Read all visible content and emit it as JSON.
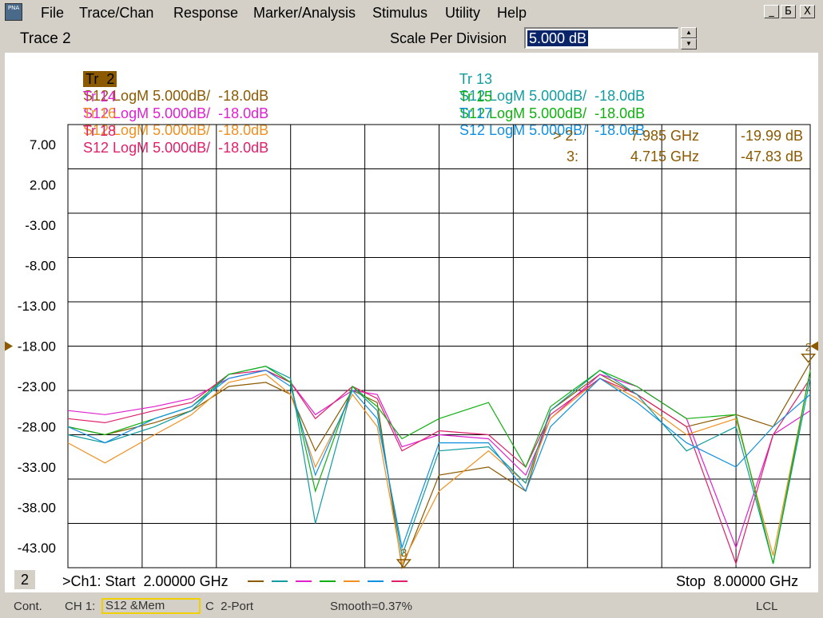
{
  "app": {
    "icon_text": "PNA"
  },
  "menu": [
    "File",
    "Trace/Chan",
    "Response",
    "Marker/Analysis",
    "Stimulus",
    "Utility",
    "Help"
  ],
  "window_controls": {
    "minimize": "_",
    "restore": "Б",
    "close": "X"
  },
  "toolbar": {
    "title": "Trace 2",
    "scale_label": "Scale Per Division",
    "scale_value": "5.000 dB"
  },
  "traces": [
    {
      "tr": "Tr  2",
      "text": "S12 LogM 5.000dB/  -18.0dB",
      "color": "#8b5a00",
      "active": true
    },
    {
      "tr": "Tr 14",
      "text": "S12 LogM 5.000dB/  -18.0dB",
      "color": "#e020d0"
    },
    {
      "tr": "Tr 16",
      "text": "S12 LogM 5.000dB/  -18.0dB",
      "color": "#f09020"
    },
    {
      "tr": "Tr 18",
      "text": "S12 LogM 5.000dB/  -18.0dB",
      "color": "#e0206a"
    },
    {
      "tr": "Tr 13",
      "text": "S12 LogM 5.000dB/  -18.0dB",
      "color": "#109ca0"
    },
    {
      "tr": "Tr 15",
      "text": "S12 LogM 5.000dB/  -18.0dB",
      "color": "#10b010"
    },
    {
      "tr": "Tr 17",
      "text": "S12 LogM 5.000dB/  -18.0dB",
      "color": "#1090e0"
    }
  ],
  "markers": [
    {
      "label": "> 2:",
      "freq": "7.985 GHz",
      "value": "-19.99 dB"
    },
    {
      "label": "3:",
      "freq": "4.715 GHz",
      "value": "-47.83 dB"
    }
  ],
  "chart_data": {
    "type": "line",
    "ylim": [
      -45.5,
      9.5
    ],
    "xlim": [
      2.0,
      8.0
    ],
    "y_ticks": [
      "7.00",
      "2.00",
      "-3.00",
      "-8.00",
      "-13.00",
      "-18.00",
      "-23.00",
      "-28.00",
      "-33.00",
      "-38.00",
      "-43.00"
    ],
    "reference_level": -18.0,
    "grid": true,
    "x_unit": "GHz",
    "y_unit": "dB",
    "marker_points": [
      {
        "name": "2",
        "x": 7.985,
        "y": -19.99
      },
      {
        "name": "3",
        "x": 4.715,
        "y": -47.83
      }
    ],
    "series": [
      {
        "color": "#8b5a00",
        "x": [
          2.0,
          2.3,
          2.7,
          3.0,
          3.3,
          3.6,
          3.8,
          4.0,
          4.3,
          4.5,
          4.7,
          5.0,
          5.4,
          5.7,
          5.9,
          6.3,
          6.6,
          7.0,
          7.4,
          7.7,
          8.0
        ],
        "y": [
          -28,
          -29,
          -27.5,
          -26,
          -23,
          -22.5,
          -24,
          -31,
          -23.5,
          -25,
          -46,
          -34,
          -33,
          -36,
          -26,
          -21.5,
          -24,
          -28,
          -26.5,
          -28,
          -20
        ]
      },
      {
        "color": "#e020d0",
        "x": [
          2.0,
          2.3,
          2.7,
          3.0,
          3.3,
          3.6,
          3.8,
          4.0,
          4.3,
          4.5,
          4.7,
          5.0,
          5.4,
          5.7,
          5.9,
          6.3,
          6.6,
          7.0,
          7.4,
          7.7,
          8.0
        ],
        "y": [
          -26,
          -26.5,
          -25.5,
          -24.5,
          -22,
          -21,
          -22.5,
          -26.5,
          -23.5,
          -24,
          -30.5,
          -29,
          -29.5,
          -34,
          -27,
          -21.5,
          -23,
          -27,
          -43,
          -29,
          -26
        ]
      },
      {
        "color": "#f09020",
        "x": [
          2.0,
          2.3,
          2.7,
          3.0,
          3.3,
          3.6,
          3.8,
          4.0,
          4.3,
          4.5,
          4.7,
          5.0,
          5.4,
          5.7,
          5.9,
          6.3,
          6.6,
          7.0,
          7.4,
          7.7,
          8.0
        ],
        "y": [
          -30,
          -32.5,
          -29,
          -26.5,
          -22.5,
          -21.5,
          -24,
          -33,
          -24,
          -28,
          -45,
          -36,
          -31,
          -35,
          -27,
          -22,
          -24.5,
          -29,
          -27,
          -44,
          -21
        ]
      },
      {
        "color": "#e0206a",
        "x": [
          2.0,
          2.3,
          2.7,
          3.0,
          3.3,
          3.6,
          3.8,
          4.0,
          4.3,
          4.5,
          4.7,
          5.0,
          5.4,
          5.7,
          5.9,
          6.3,
          6.6,
          7.0,
          7.4,
          7.7,
          8.0
        ],
        "y": [
          -27,
          -27.5,
          -26,
          -25,
          -21.5,
          -21,
          -22.5,
          -27,
          -23,
          -24.5,
          -31,
          -28.5,
          -29,
          -33,
          -26.5,
          -22,
          -24,
          -28,
          -45,
          -29,
          -22
        ]
      },
      {
        "color": "#109ca0",
        "x": [
          2.0,
          2.3,
          2.7,
          3.0,
          3.3,
          3.6,
          3.8,
          4.0,
          4.3,
          4.5,
          4.7,
          5.0,
          5.4,
          5.7,
          5.9,
          6.3,
          6.6,
          7.0,
          7.4,
          7.7,
          8.0
        ],
        "y": [
          -29,
          -30,
          -28,
          -26,
          -21.5,
          -20.5,
          -22,
          -40,
          -23,
          -26,
          -44,
          -31,
          -30.5,
          -35,
          -26,
          -21,
          -24,
          -31,
          -28,
          -45,
          -22
        ]
      },
      {
        "color": "#10b010",
        "x": [
          2.0,
          2.3,
          2.7,
          3.0,
          3.3,
          3.6,
          3.8,
          4.0,
          4.3,
          4.5,
          4.7,
          5.0,
          5.4,
          5.7,
          5.9,
          6.3,
          6.6,
          7.0,
          7.4,
          7.7,
          8.0
        ],
        "y": [
          -28,
          -29,
          -27,
          -25.5,
          -21.5,
          -20.5,
          -22.5,
          -36,
          -23,
          -25.5,
          -29.5,
          -27,
          -25,
          -33,
          -25.5,
          -21,
          -23,
          -27,
          -26.5,
          -45,
          -21
        ]
      },
      {
        "color": "#1090e0",
        "x": [
          2.0,
          2.3,
          2.7,
          3.0,
          3.3,
          3.6,
          3.8,
          4.0,
          4.3,
          4.5,
          4.7,
          5.0,
          5.4,
          5.7,
          5.9,
          6.3,
          6.6,
          7.0,
          7.4,
          7.7,
          8.0
        ],
        "y": [
          -28,
          -30,
          -27,
          -25.5,
          -22,
          -21,
          -23,
          -34,
          -23.5,
          -27,
          -43,
          -30,
          -30,
          -36,
          -28,
          -22,
          -25,
          -30,
          -33,
          -28,
          -24
        ]
      }
    ]
  },
  "footer": {
    "channel_number": "2",
    "start_text": ">Ch1: Start  2.00000 GHz",
    "stop_text": "Stop  8.00000 GHz",
    "legend_colors": [
      "#8b5a00",
      "#109ca0",
      "#e020d0",
      "#10b010",
      "#f09020",
      "#1090e0",
      "#e0206a"
    ]
  },
  "status": {
    "mode": "Cont.",
    "channel": "CH 1:",
    "measurement": "S12 &Mem",
    "cal": "C  2-Port",
    "smoothing": "Smooth=0.37%",
    "reference": "LCL"
  }
}
